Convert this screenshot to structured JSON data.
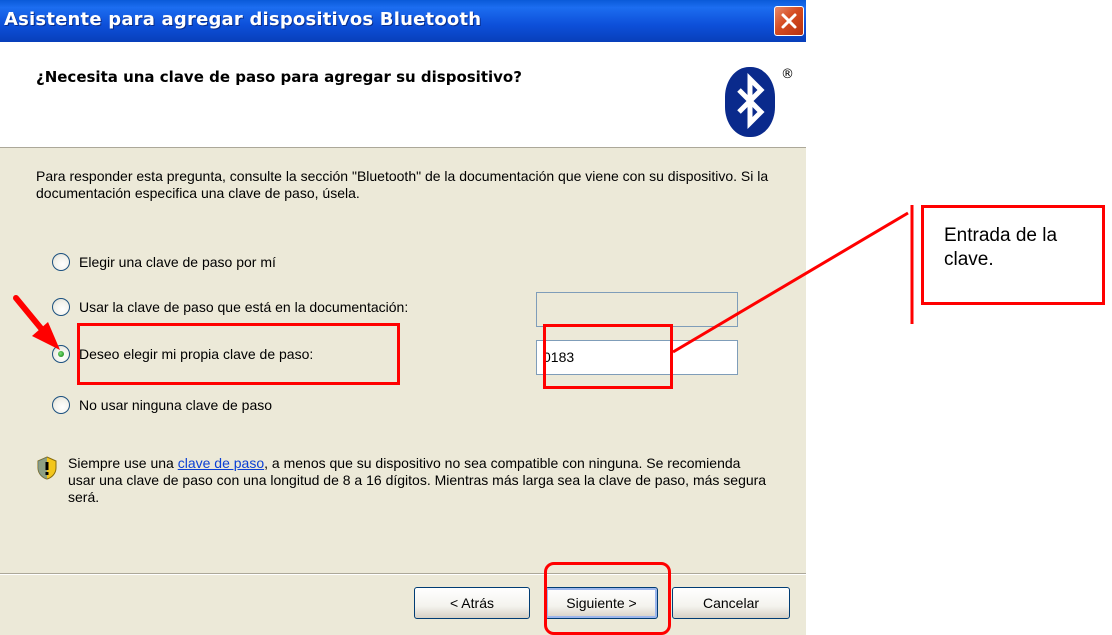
{
  "window": {
    "title": "Asistente para agregar dispositivos Bluetooth",
    "header_heading": "¿Necesita una clave de paso para agregar su dispositivo?",
    "logo_mark": "®"
  },
  "instructions": "Para responder esta pregunta, consulte la sección \"Bluetooth\" de la documentación que viene con su dispositivo. Si la documentación especifica una clave de paso, úsela.",
  "options": [
    {
      "label": "Elegir una clave de paso por mí",
      "selected": false
    },
    {
      "label": "Usar la clave de paso que está en la documentación:",
      "selected": false
    },
    {
      "label": "Deseo elegir mi propia clave de paso:",
      "selected": true
    },
    {
      "label": "No usar ninguna clave de paso",
      "selected": false
    }
  ],
  "fields": {
    "documentation_passkey": "",
    "own_passkey": "0183"
  },
  "info": {
    "prefix": "Siempre use una ",
    "link": "clave de paso",
    "suffix": ", a menos que su dispositivo no sea compatible con ninguna. Se recomienda usar una clave de paso con una longitud de 8 a 16 dígitos. Mientras más larga sea la clave de paso, más segura será."
  },
  "buttons": {
    "back": "< Atrás",
    "next": "Siguiente >",
    "cancel": "Cancelar"
  },
  "annotation": {
    "callout_text": "Entrada de la clave.",
    "color": "#ff0000"
  },
  "colors": {
    "titlebar": "#0d4fd9",
    "dialog_bg": "#ece9d8",
    "link": "#0b3fd4"
  }
}
